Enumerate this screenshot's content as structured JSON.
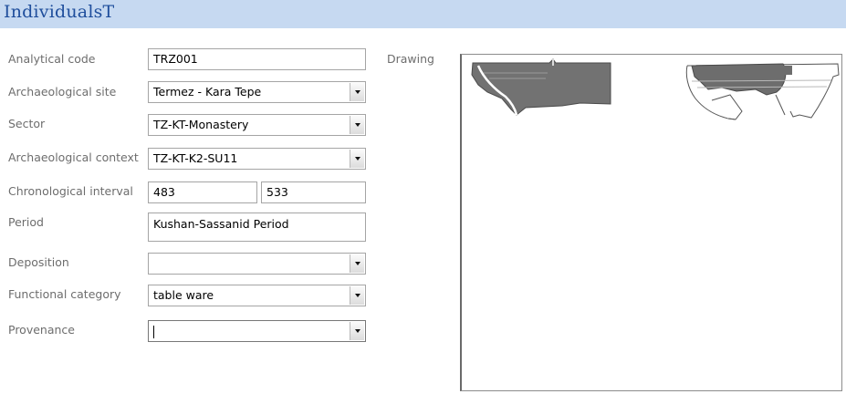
{
  "window": {
    "title": "IndividualsT"
  },
  "labels": {
    "analytical_code": "Analytical code",
    "archaeological_site": "Archaeological site",
    "sector": "Sector",
    "archaeological_context": "Archaeological context",
    "chronological_interval": "Chronological interval",
    "period": "Period",
    "deposition": "Deposition",
    "functional_category": "Functional category",
    "provenance": "Provenance",
    "drawing": "Drawing"
  },
  "values": {
    "analytical_code": "TRZ001",
    "archaeological_site": "Termez - Kara Tepe",
    "sector": "TZ-KT-Monastery",
    "archaeological_context": "TZ-KT-K2-SU11",
    "interval_start": "483",
    "interval_end": "533",
    "period": "Kushan-Sassanid Period",
    "deposition": "",
    "functional_category": "table ware",
    "provenance": ""
  },
  "icons": {
    "dropdown": "chevron-down-icon"
  },
  "colors": {
    "header_bg": "#c6d9f1",
    "header_text": "#1f4e9c",
    "label_text": "#6d6d6d"
  }
}
